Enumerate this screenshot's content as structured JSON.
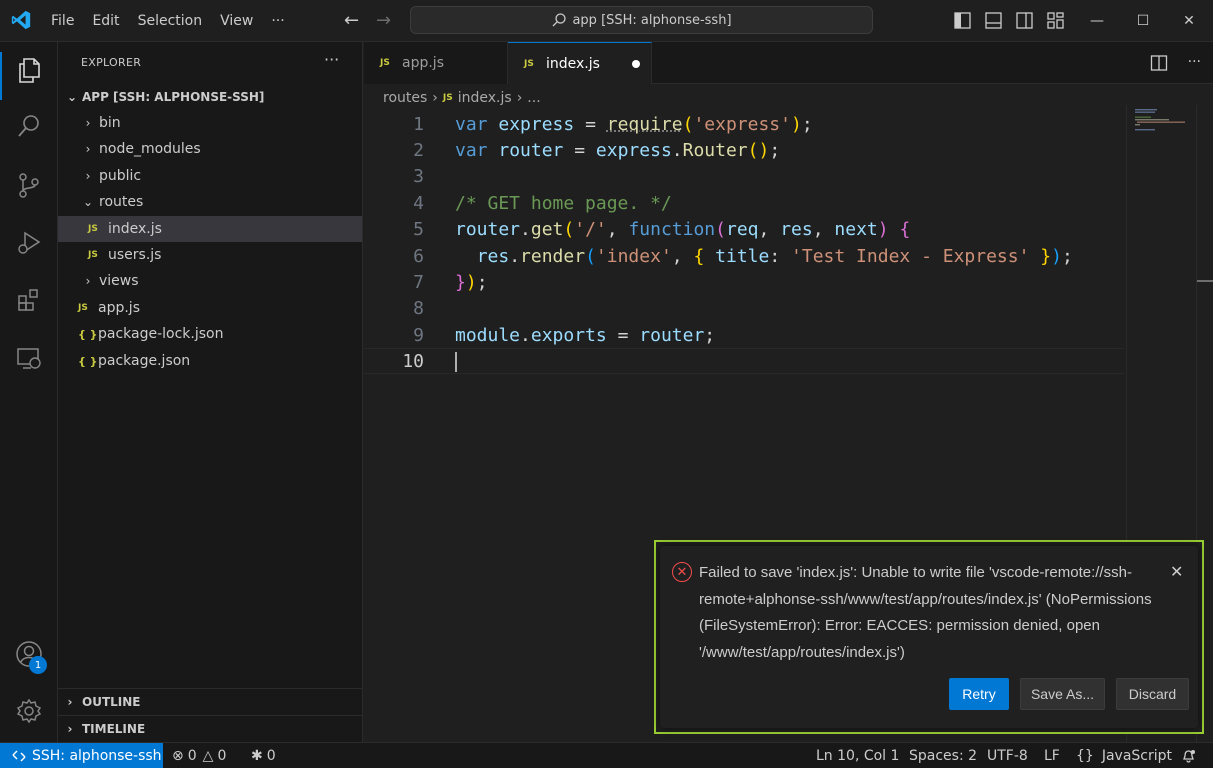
{
  "titlebar": {
    "menu": [
      "File",
      "Edit",
      "Selection",
      "View",
      "···"
    ],
    "search_text": "app [SSH: alphonse-ssh]"
  },
  "sidebar": {
    "header": "EXPLORER",
    "more": "···",
    "root": "APP [SSH: ALPHONSE-SSH]",
    "items": [
      {
        "label": "bin",
        "type": "folder",
        "expanded": false
      },
      {
        "label": "node_modules",
        "type": "folder",
        "expanded": false
      },
      {
        "label": "public",
        "type": "folder",
        "expanded": false
      },
      {
        "label": "routes",
        "type": "folder",
        "expanded": true
      },
      {
        "label": "index.js",
        "type": "js",
        "selected": true
      },
      {
        "label": "users.js",
        "type": "js"
      },
      {
        "label": "views",
        "type": "folder",
        "expanded": false
      },
      {
        "label": "app.js",
        "type": "js"
      },
      {
        "label": "package-lock.json",
        "type": "json"
      },
      {
        "label": "package.json",
        "type": "json"
      }
    ],
    "outline": "OUTLINE",
    "timeline": "TIMELINE",
    "accounts_badge": "1"
  },
  "editor": {
    "tabs": [
      {
        "label": "app.js",
        "active": false
      },
      {
        "label": "index.js",
        "active": true,
        "dirty": true
      }
    ],
    "breadcrumb": [
      "routes",
      "index.js",
      "..."
    ],
    "js_badge": "JS",
    "json_badge": "{ }",
    "line_numbers": [
      "1",
      "2",
      "3",
      "4",
      "5",
      "6",
      "7",
      "8",
      "9",
      "10"
    ],
    "current_line": "10"
  },
  "notification": {
    "message": "Failed to save 'index.js': Unable to write file 'vscode-remote://ssh-remote+alphonse-ssh/www/test/app/routes/index.js' (NoPermissions (FileSystemError): Error: EACCES: permission denied, open '/www/test/app/routes/index.js')",
    "buttons": {
      "retry": "Retry",
      "save_as": "Save As...",
      "discard": "Discard"
    },
    "border_color": "#9acd32"
  },
  "statusbar": {
    "remote": "SSH: alphonse-ssh",
    "errors": "0",
    "warnings": "0",
    "ports": "0",
    "position": "Ln 10, Col 1",
    "indent": "Spaces: 2",
    "encoding": "UTF-8",
    "eol": "LF",
    "language": "JavaScript",
    "accent": "#0078d4"
  }
}
